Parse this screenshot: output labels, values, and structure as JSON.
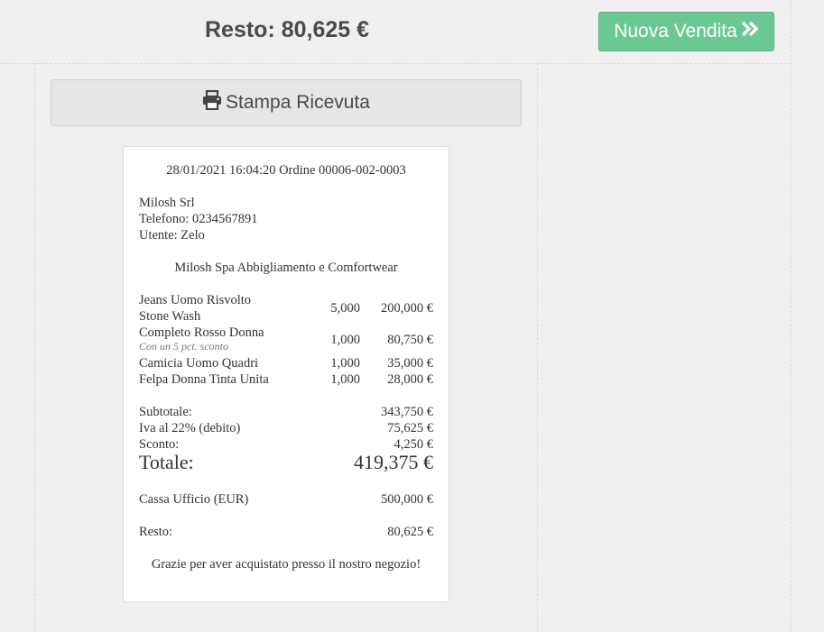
{
  "header": {
    "resto_label": "Resto: 80,625 €",
    "new_sale_label": "Nuova Vendita",
    "print_label": "Stampa Ricevuta"
  },
  "receipt": {
    "datetime_order": "28/01/2021 16:04:20 Ordine 00006-002-0003",
    "company": "Milosh Srl",
    "phone": "Telefono: 0234567891",
    "user": "Utente: Zelo",
    "store_name": "Milosh Spa Abbigliamento e Comfortwear",
    "items": [
      {
        "name1": "Jeans Uomo Risvolto",
        "name2": "Stone Wash",
        "qty": "5,000",
        "price": "200,000 €"
      },
      {
        "name1": "Completo Rosso Donna",
        "note": "Con un 5 pct. sconto",
        "qty": "1,000",
        "price": "80,750 €"
      },
      {
        "name1": "Camicia Uomo Quadri",
        "qty": "1,000",
        "price": "35,000 €"
      },
      {
        "name1": "Felpa Donna Tinta Unita",
        "qty": "1,000",
        "price": "28,000 €"
      }
    ],
    "subtotal_label": "Subtotale:",
    "subtotal_value": "343,750 €",
    "vat_label": "Iva al 22% (debito)",
    "vat_value": "75,625 €",
    "discount_label": "Sconto:",
    "discount_value": "4,250 €",
    "total_label": "Totale:",
    "total_value": "419,375 €",
    "payment_label": "Cassa Ufficio (EUR)",
    "payment_value": "500,000 €",
    "change_label": "Resto:",
    "change_value": "80,625 €",
    "thanks": "Grazie per aver acquistato presso il nostro negozio!"
  },
  "icons": {
    "print": "printer-icon",
    "next": "double-chevron-right-icon"
  },
  "colors": {
    "accent": "#6bc895",
    "background": "#f0eeee"
  }
}
